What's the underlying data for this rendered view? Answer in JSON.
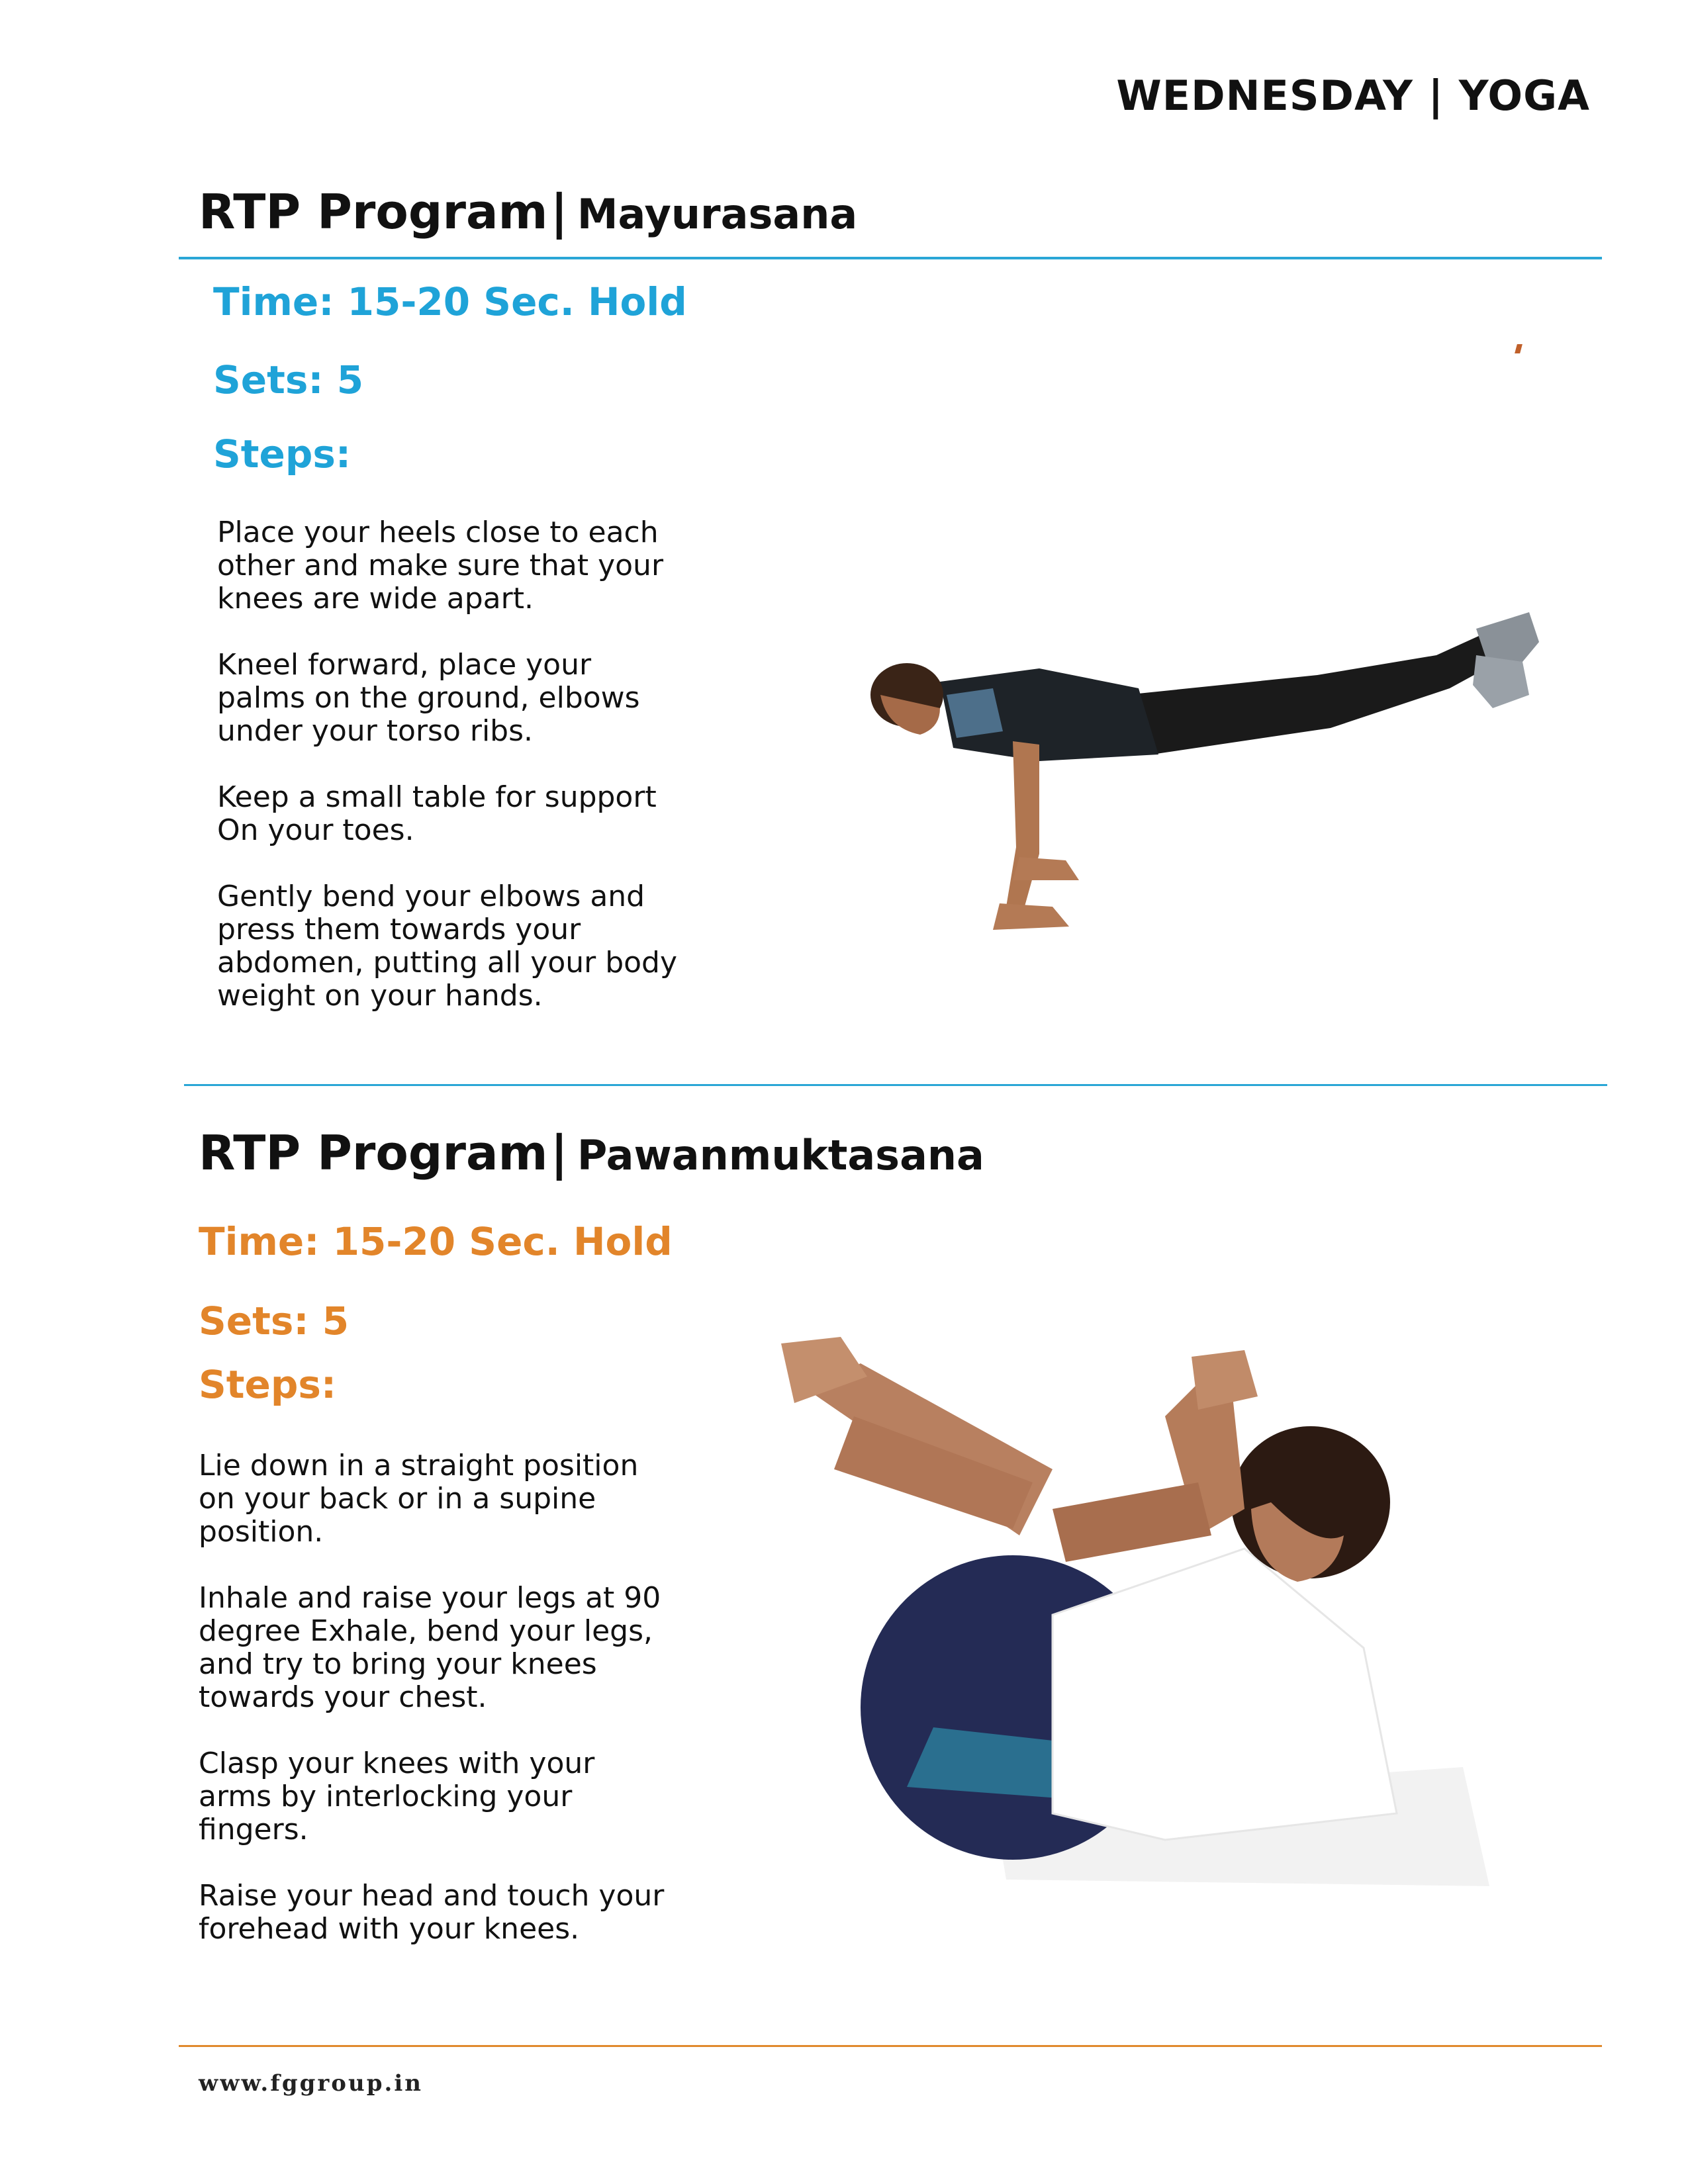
{
  "header": {
    "day_label": "WEDNESDAY | YOGA"
  },
  "section1": {
    "program_label": "RTP Program",
    "separator": "|",
    "pose_name": "Mayurasana",
    "time": "Time: 15-20 Sec. Hold",
    "sets": "Sets: 5",
    "steps_heading": "Steps:",
    "steps": [
      "Place your heels close to each other and make sure that your knees are wide apart.",
      "Kneel forward, place your palms on the ground, elbows under your torso ribs.",
      "Keep a small table for support On your toes.",
      "Gently bend your elbows and press them towards your abdomen, putting all your body weight on your hands."
    ],
    "accent_color": "#1fa3d8"
  },
  "section2": {
    "program_label": "RTP Program",
    "separator": "|",
    "pose_name": "Pawanmuktasana",
    "time": "Time: 15-20 Sec. Hold",
    "sets": "Sets: 5",
    "steps_heading": "Steps:",
    "steps": [
      "Lie down in a straight position on your back or in a supine position.",
      "Inhale and raise your legs at 90 degree Exhale, bend your legs, and try to bring your knees towards your chest.",
      "Clasp your knees with your arms by interlocking your fingers.",
      "Raise your head and touch your forehead with your knees."
    ],
    "accent_color": "#e2852a"
  },
  "footer": {
    "url": "www.fggroup.in"
  }
}
